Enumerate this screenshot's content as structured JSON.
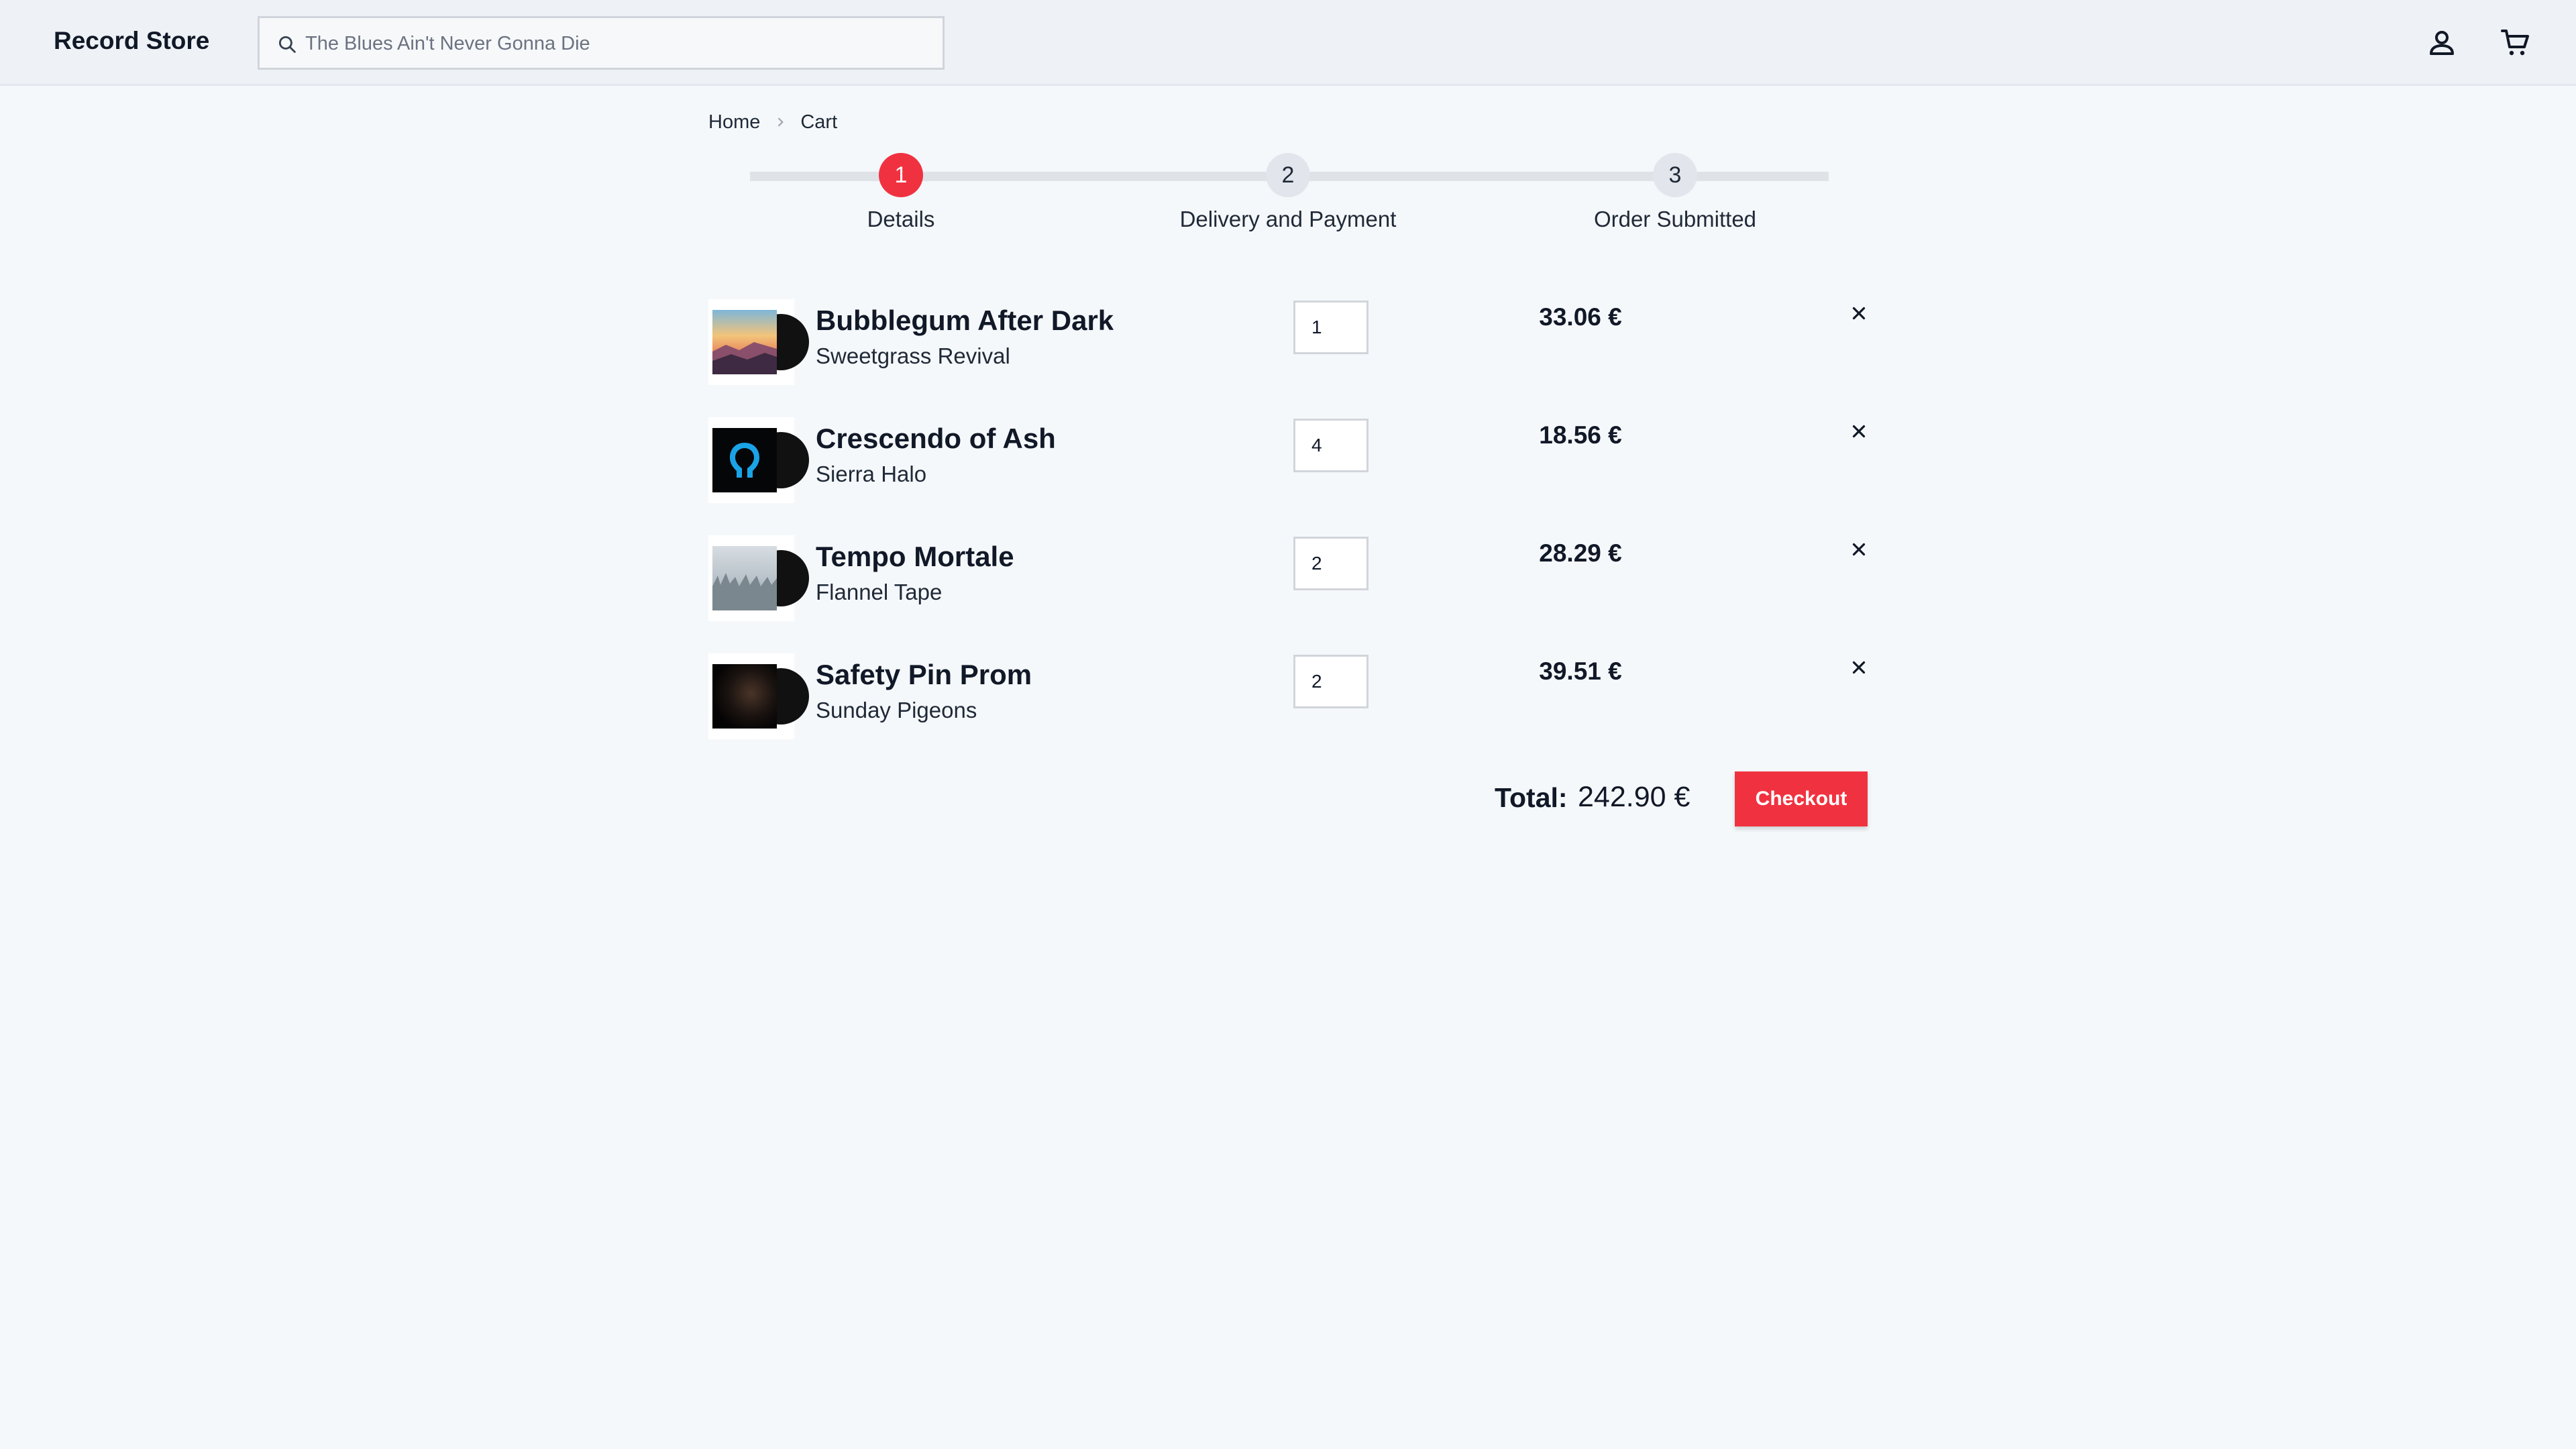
{
  "header": {
    "brand": "Record Store",
    "search_placeholder": "The Blues Ain't Never Gonna Die",
    "icons": {
      "search": "search-icon",
      "user": "user-icon",
      "cart": "cart-icon"
    }
  },
  "breadcrumb": {
    "home": "Home",
    "current": "Cart"
  },
  "steps": [
    {
      "number": "1",
      "label": "Details",
      "active": true
    },
    {
      "number": "2",
      "label": "Delivery and Payment",
      "active": false
    },
    {
      "number": "3",
      "label": "Order Submitted",
      "active": false
    }
  ],
  "cart": {
    "items": [
      {
        "title": "Bubblegum After Dark",
        "artist": "Sweetgrass Revival",
        "quantity": "1",
        "price": "33.06 €"
      },
      {
        "title": "Crescendo of Ash",
        "artist": "Sierra Halo",
        "quantity": "4",
        "price": "18.56 €"
      },
      {
        "title": "Tempo Mortale",
        "artist": "Flannel Tape",
        "quantity": "2",
        "price": "28.29 €"
      },
      {
        "title": "Safety Pin Prom",
        "artist": "Sunday Pigeons",
        "quantity": "2",
        "price": "39.51 €"
      }
    ],
    "total_label": "Total:",
    "total_value": "242.90 €",
    "checkout_label": "Checkout"
  },
  "colors": {
    "accent": "#f03240",
    "background": "#f5f8fa",
    "header_bg": "#eef2f6"
  }
}
